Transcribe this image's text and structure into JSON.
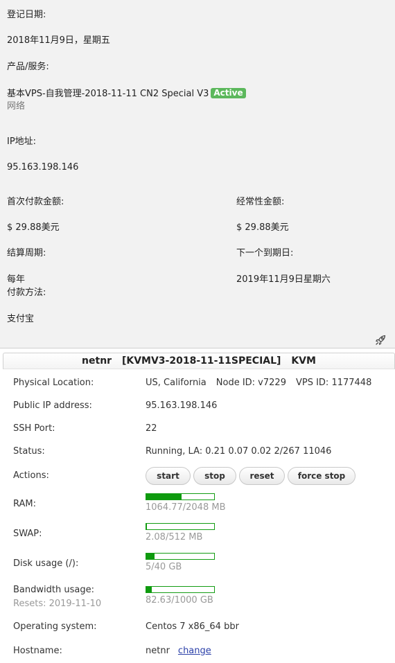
{
  "account": {
    "reg_date_label": "登记日期:",
    "reg_date_value": "2018年11月9日，星期五",
    "product_label": "产品/服务:",
    "product_name": "基本VPS-自我管理-2018-11-11 CN2 Special V3",
    "product_status": "Active",
    "product_group": "网络",
    "ip_label": "IP地址:",
    "ip_value": "95.163.198.146",
    "first_payment_label": "首次付款金额:",
    "first_payment_value": "$ 29.88美元",
    "recurring_label": "经常性金额:",
    "recurring_value": "$ 29.88美元",
    "billing_cycle_label": "结算周期:",
    "billing_cycle_value": "每年",
    "next_due_label": "下一个到期日:",
    "next_due_value": "2019年11月9日星期六",
    "payment_method_label": "付款方法:",
    "payment_method_value": "支付宝",
    "rocket_icon": "rocket-icon"
  },
  "vps": {
    "header": {
      "hostname": "netnr",
      "plan": "[KVMV3-2018-11-11SPECIAL]",
      "type": "KVM"
    },
    "location_label": "Physical Location:",
    "location_value": "US, California",
    "node_id": "Node ID: v7229",
    "vps_id": "VPS ID: 1177448",
    "public_ip_label": "Public IP address:",
    "public_ip_value": "95.163.198.146",
    "ssh_port_label": "SSH Port:",
    "ssh_port_value": "22",
    "status_label": "Status:",
    "status_value": "Running, LA: 0.21 0.07 0.02 2/267 11046",
    "actions_label": "Actions:",
    "actions": {
      "start": "start",
      "stop": "stop",
      "reset": "reset",
      "force_stop": "force stop"
    },
    "ram_label": "RAM:",
    "ram_value": "1064.77/2048 MB",
    "ram_fraction": 0.52,
    "swap_label": "SWAP:",
    "swap_value": "2.08/512 MB",
    "swap_fraction": 0.004,
    "disk_label": "Disk usage (/):",
    "disk_value": "5/40 GB",
    "disk_fraction": 0.125,
    "bw_label": "Bandwidth usage:",
    "bw_resets": "Resets: 2019-11-10",
    "bw_value": "82.63/1000 GB",
    "bw_fraction": 0.083,
    "os_label": "Operating system:",
    "os_value": "Centos 7 x86_64 bbr",
    "hostname_label": "Hostname:",
    "hostname_value": "netnr",
    "hostname_change": "change",
    "bar_color": "#0e9a0e"
  }
}
